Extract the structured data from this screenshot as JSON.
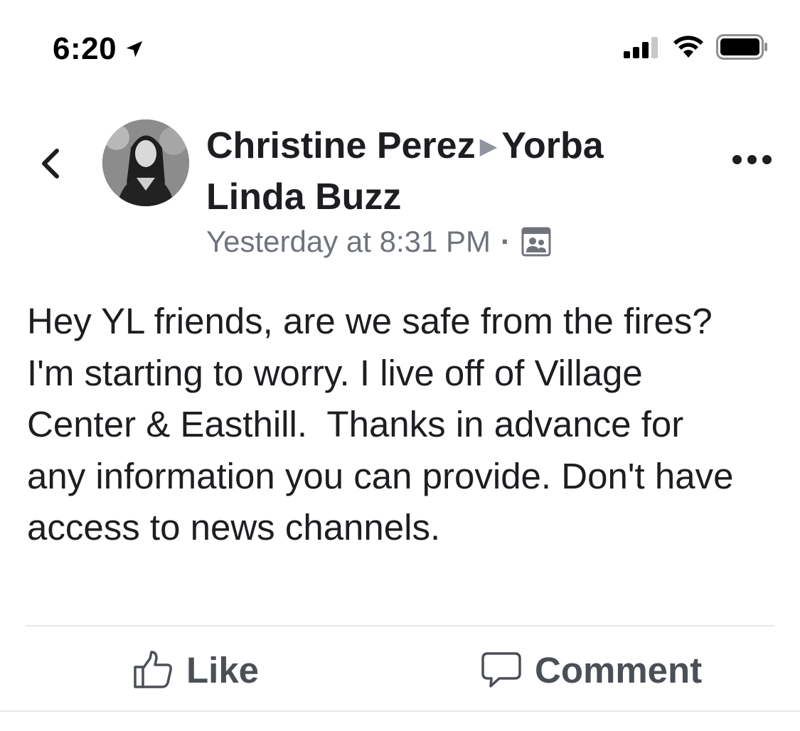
{
  "status_bar": {
    "time": "6:20",
    "icons": [
      "location-arrow-icon",
      "cellular-signal-icon",
      "wifi-icon",
      "battery-icon"
    ]
  },
  "post": {
    "author": "Christine Perez",
    "group": "Yorba Linda Buzz",
    "timestamp": "Yesterday at 8:31 PM",
    "audience_icon": "group-audience-icon",
    "body": "Hey YL friends, are we safe from the fires? I'm starting to worry. I live off of Village Center & Easthill.  Thanks in advance for any information you can provide. Don't have access to news channels."
  },
  "actions": {
    "like_label": "Like",
    "comment_label": "Comment"
  },
  "colors": {
    "text_primary": "#1c1e21",
    "text_secondary": "#6f747b",
    "action_text": "#4b4f56",
    "divider": "#e4e6eb"
  }
}
